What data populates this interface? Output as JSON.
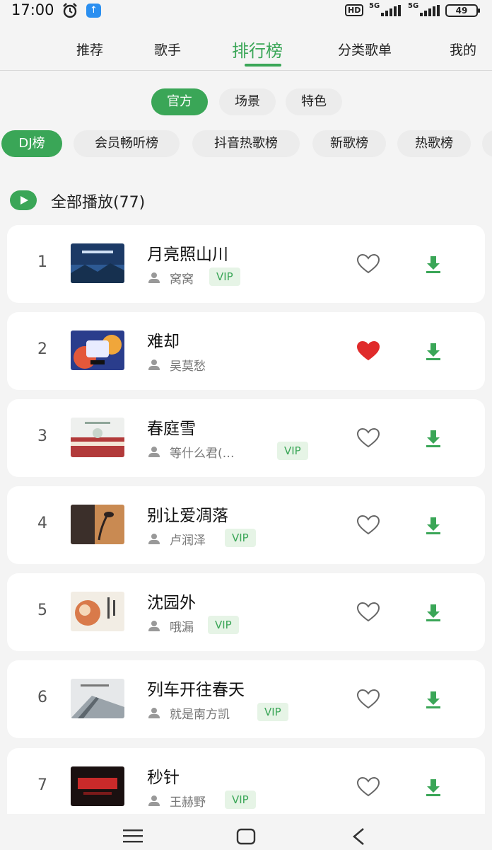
{
  "status_bar": {
    "time": "17:00",
    "hd": "HD",
    "signal1": "5G",
    "signal2": "5G",
    "battery": "49"
  },
  "nav": {
    "tabs": [
      "推荐",
      "歌手",
      "排行榜",
      "分类歌单",
      "我的"
    ],
    "active_index": 2
  },
  "rank_types": [
    "官方",
    "场景",
    "特色"
  ],
  "rank_lists": [
    "DJ榜",
    "会员畅听榜",
    "抖音热歌榜",
    "新歌榜",
    "热歌榜"
  ],
  "play_all": {
    "label": "全部播放(77)"
  },
  "songs": [
    {
      "rank": "1",
      "title": "月亮照山川",
      "artist": "窝窝",
      "vip": "VIP",
      "liked": false
    },
    {
      "rank": "2",
      "title": "难却",
      "artist": "吴莫愁",
      "vip": "",
      "liked": true
    },
    {
      "rank": "3",
      "title": "春庭雪",
      "artist": "等什么君(…",
      "vip": "VIP",
      "liked": false
    },
    {
      "rank": "4",
      "title": "别让爱凋落",
      "artist": "卢润泽",
      "vip": "VIP",
      "liked": false
    },
    {
      "rank": "5",
      "title": "沈园外",
      "artist": "哦漏",
      "vip": "VIP",
      "liked": false
    },
    {
      "rank": "6",
      "title": "列车开往春天",
      "artist": "就是南方凯",
      "vip": "VIP",
      "liked": false
    },
    {
      "rank": "7",
      "title": "秒针",
      "artist": "王赫野",
      "vip": "VIP",
      "liked": false
    }
  ],
  "colors": {
    "accent": "#3aa657",
    "like_red": "#e02b2b",
    "vip_bg": "#e6f4e6"
  },
  "icons": {
    "play_all": "play-icon",
    "like": "heart-icon",
    "download": "download-icon",
    "artist": "person-icon"
  }
}
